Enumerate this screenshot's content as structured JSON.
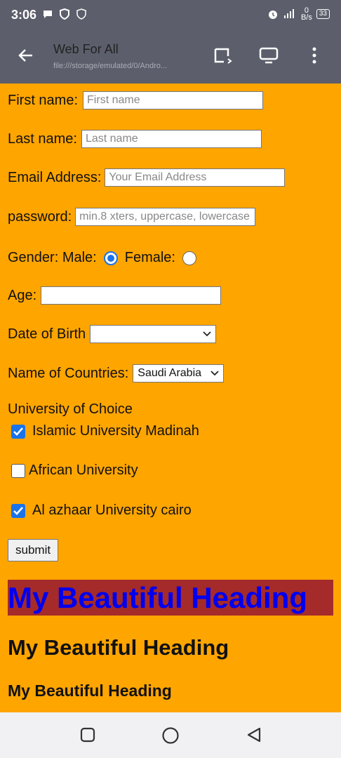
{
  "status": {
    "time": "3:06",
    "network_rate_top": "0",
    "network_rate_unit": "B/s",
    "battery": "33"
  },
  "appbar": {
    "title": "Web For All",
    "url": "file:///storage/emulated/0/Andro..."
  },
  "form": {
    "first_name_label": "First name:",
    "first_name_placeholder": "First name",
    "last_name_label": "Last name:",
    "last_name_placeholder": "Last name",
    "email_label": "Email Address:",
    "email_placeholder": "Your Email Address",
    "password_label": "password:",
    "password_placeholder": "min.8 xters, uppercase, lowercase",
    "gender_label": "Gender: Male:",
    "female_label": "Female:",
    "gender_selected": "Male",
    "age_label": "Age:",
    "age_value": "",
    "dob_label": "Date of Birth",
    "dob_value": "",
    "countries_label": "Name of Countries:",
    "countries_selected": "Saudi Arabia",
    "university_heading": "University of Choice",
    "universities": [
      {
        "label": "Islamic University Madinah",
        "checked": true
      },
      {
        "label": "African University",
        "checked": false
      },
      {
        "label": "Al azhaar University cairo",
        "checked": true
      }
    ],
    "submit_label": "submit"
  },
  "headings": {
    "h1": "My Beautiful Heading",
    "h2": "My Beautiful Heading",
    "h3": "My Beautiful Heading"
  },
  "colors": {
    "page_background": "#ffa500",
    "heading_background": "#a52a2a",
    "heading_text": "#0000ee",
    "accent": "#1a73e8",
    "status_bar": "#5c5f6b"
  }
}
